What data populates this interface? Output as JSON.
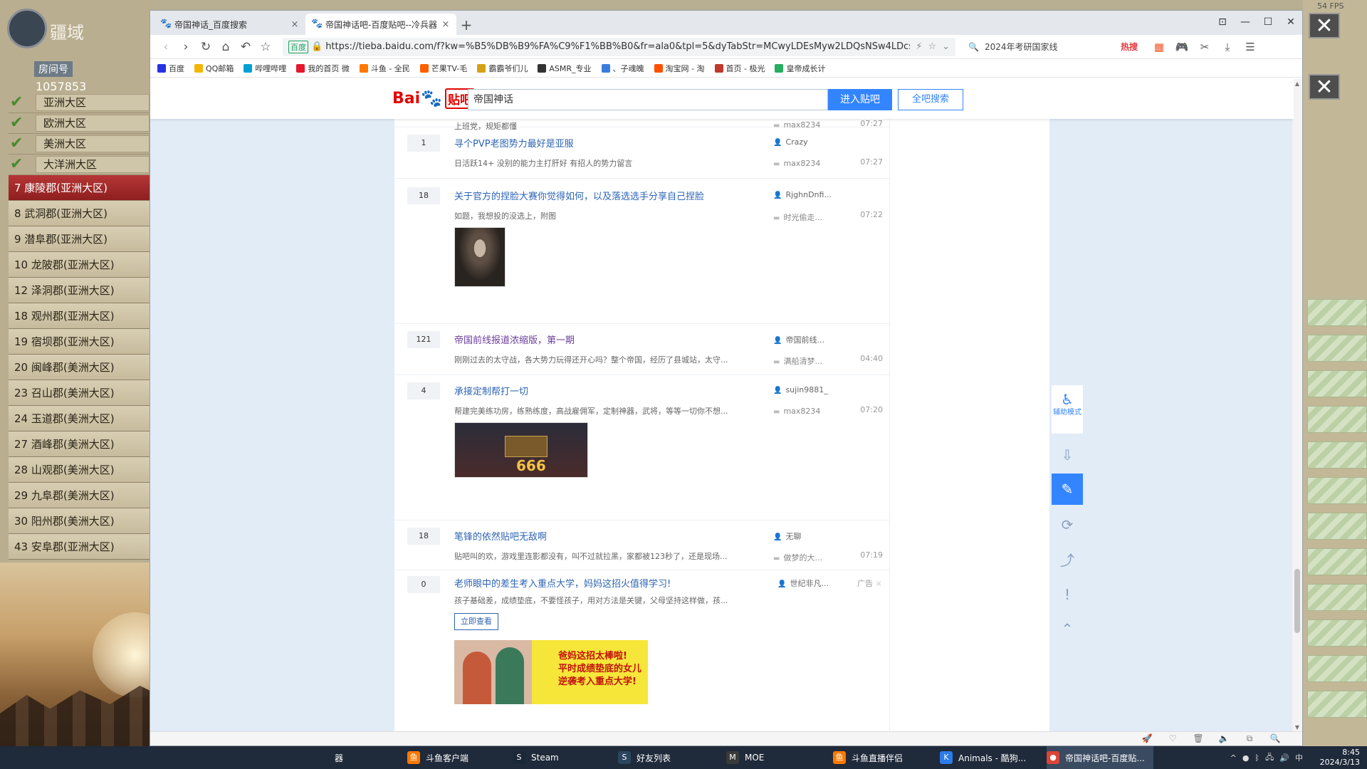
{
  "game": {
    "logo_word": "疆域",
    "room_label": "房间号",
    "room_number": "1057853",
    "regions": [
      "亚洲大区",
      "欧洲大区",
      "美洲大区",
      "大洋洲大区"
    ],
    "counties": [
      {
        "label": "7 康陵郡(亚洲大区)",
        "active": true
      },
      {
        "label": "8 武洞郡(亚洲大区)",
        "active": false
      },
      {
        "label": "9 潜阜郡(亚洲大区)",
        "active": false
      },
      {
        "label": "10 龙陂郡(亚洲大区)",
        "active": false
      },
      {
        "label": "12 泽洞郡(亚洲大区)",
        "active": false
      },
      {
        "label": "18 观州郡(亚洲大区)",
        "active": false
      },
      {
        "label": "19 宿坝郡(亚洲大区)",
        "active": false
      },
      {
        "label": "20 闽峰郡(美洲大区)",
        "active": false
      },
      {
        "label": "23 召山郡(美洲大区)",
        "active": false
      },
      {
        "label": "24 玉道郡(美洲大区)",
        "active": false
      },
      {
        "label": "27 酒峰郡(美洲大区)",
        "active": false
      },
      {
        "label": "28 山观郡(美洲大区)",
        "active": false
      },
      {
        "label": "29 九阜郡(美洲大区)",
        "active": false
      },
      {
        "label": "30 阳州郡(美洲大区)",
        "active": false
      },
      {
        "label": "43 安阜郡(亚洲大区)",
        "active": false
      }
    ],
    "fps": "54 FPS"
  },
  "browser": {
    "tabs": [
      {
        "title": "帝国神话_百度搜索",
        "active": false
      },
      {
        "title": "帝国神话吧-百度贴吧--冷兵器",
        "active": true
      }
    ],
    "new_tab": "+",
    "url": "https://tieba.baidu.com/f?kw=%B5%DB%B9%FA%C9%F1%BB%B0&fr=ala0&tpl=5&dyTabStr=MCwyLDEsMyw2LDQsNSw4LDcs",
    "secure_label": "百度",
    "search_query": "2024年考研国家线",
    "hot_label": "热搜",
    "bookmarks": [
      {
        "label": "百度",
        "color": "#2932e1"
      },
      {
        "label": "QQ邮箱",
        "color": "#f2b705"
      },
      {
        "label": "哔哩哔哩",
        "color": "#00a1d6"
      },
      {
        "label": "我的首页 微",
        "color": "#e6162d"
      },
      {
        "label": "斗鱼 - 全民",
        "color": "#ff7800"
      },
      {
        "label": "芒果TV-毛",
        "color": "#ff5f00"
      },
      {
        "label": "霸霸爷们儿",
        "color": "#d4a017"
      },
      {
        "label": "ASMR_专业",
        "color": "#333333"
      },
      {
        "label": "、子魂魄",
        "color": "#3b7ddd"
      },
      {
        "label": "淘宝网 - 淘",
        "color": "#ff5000"
      },
      {
        "label": "首页 - 极光",
        "color": "#c0392b"
      },
      {
        "label": "皇帝成长计",
        "color": "#27ae60"
      }
    ]
  },
  "tieba": {
    "logo_bai": "Bai",
    "logo_tieba": "贴吧",
    "search_value": "帝国神话",
    "enter_label": "进入贴吧",
    "all_search_label": "全吧搜索",
    "threads": [
      {
        "reply": "",
        "title": "",
        "abstract": "上班党，规矩都懂",
        "author": "",
        "last_user": "max8234",
        "time": "07:27"
      },
      {
        "reply": "1",
        "title": "寻个PVP老图势力最好是亚服",
        "abstract": "日活跃14+ 没别的能力主打肝好 有招人的势力留言",
        "author": "Crazy",
        "last_user": "max8234",
        "time": "07:27",
        "time2": "07:27"
      },
      {
        "reply": "18",
        "title": "关于官方的捏脸大赛你觉得如何，以及落选选手分享自己捏脸",
        "abstract": "如题，我想投的没选上，附图",
        "author": "RjghnDnfi...",
        "last_user": "时光偷走...",
        "time": "07:22"
      },
      {
        "reply": "121",
        "title": "帝国前线报道浓缩版，第一期",
        "abstract": "刚刚过去的太守战，各大势力玩得还开心吗？整个帝国，经历了县城站，太守...",
        "author": "帝国前线...",
        "last_user": "满船清梦...",
        "time": "04:40"
      },
      {
        "reply": "4",
        "title": "承接定制帮打一切",
        "abstract": "帮建完美练功房，练熟练度，高战雇佣军，定制神器，武将，等等一切你不想...",
        "author": "sujin9881_",
        "last_user": "max8234",
        "time": "07:20"
      },
      {
        "reply": "18",
        "title": "笔锋的依然贴吧无敌啊",
        "abstract": "贴吧叫的欢，游戏里连影都没有，叫不过就拉黑，家都被123秒了，还是现场...",
        "author": "无聊",
        "last_user": "做梦的大...",
        "time": "07:19"
      },
      {
        "reply": "0",
        "title": "老师眼中的差生考入重点大学，妈妈这招火值得学习!",
        "abstract": "孩子基础差，成绩垫底，不要怪孩子，用对方法是关键，父母坚持这样做，孩...",
        "author": "世纪非凡...",
        "last_user": "",
        "time": "",
        "ad_label": "广告"
      }
    ],
    "game_thumb_text": "666",
    "ad_button": "立即查看",
    "ad_slogan": [
      "爸妈这招太棒啦!",
      "平时成绩垫底的女儿",
      "逆袭考入重点大学!"
    ],
    "side_helper_label": "辅助模式"
  },
  "taskbar": {
    "items": [
      {
        "label": "器",
        "icon": "browser-icon",
        "color": "#e2813a"
      },
      {
        "label": "斗鱼客户端",
        "icon": "douyu-icon",
        "color": "#ff7800"
      },
      {
        "label": "Steam",
        "icon": "steam-icon",
        "color": "#1b2838"
      },
      {
        "label": "好友列表",
        "icon": "steam-friends-icon",
        "color": "#2a475e"
      },
      {
        "label": "MOE",
        "icon": "moe-icon",
        "color": "#3a3a3a"
      },
      {
        "label": "斗鱼直播伴侣",
        "icon": "douyu-live-icon",
        "color": "#ff7800"
      },
      {
        "label": "Animals - 酷狗...",
        "icon": "kugou-icon",
        "color": "#2b7ce9"
      },
      {
        "label": "帝国神话吧-百度贴...",
        "icon": "chrome-icon",
        "color": "#db4437"
      }
    ],
    "time": "8:45",
    "date": "2024/3/13",
    "ime": "中"
  }
}
